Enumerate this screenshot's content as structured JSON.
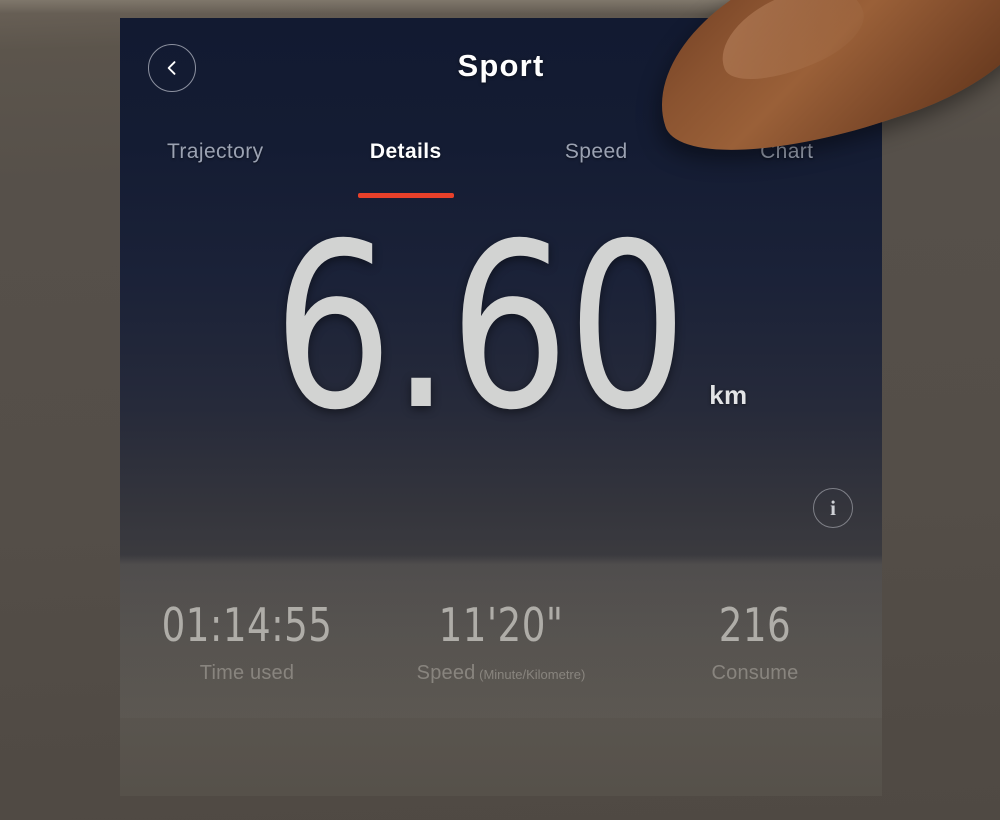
{
  "header": {
    "title": "Sport",
    "back_icon": "chevron-left-icon",
    "camera_icon": "camera-icon",
    "refresh_icon": "refresh-icon"
  },
  "tabs": [
    {
      "label": "Trajectory",
      "active": false
    },
    {
      "label": "Details",
      "active": true
    },
    {
      "label": "Speed",
      "active": false
    },
    {
      "label": "Chart",
      "active": false
    }
  ],
  "hero": {
    "distance_value": "6.60",
    "distance_unit": "km",
    "info_icon": "info-icon",
    "info_label": "i"
  },
  "stats": [
    {
      "value": "01:14:55",
      "label": "Time used",
      "sub": ""
    },
    {
      "value": "11'20\"",
      "label": "Speed",
      "sub": " (Minute/Kilometre)"
    },
    {
      "value": "216",
      "label": "Consume",
      "sub": ""
    }
  ],
  "colors": {
    "accent": "#e8402a",
    "screen_top": "#121a31",
    "screen_bottom": "#4e4a46",
    "backdrop": "#56504a",
    "text_primary": "#ffffff",
    "text_muted": "#9ba2b2",
    "hero_value": "#d2d3d2"
  }
}
